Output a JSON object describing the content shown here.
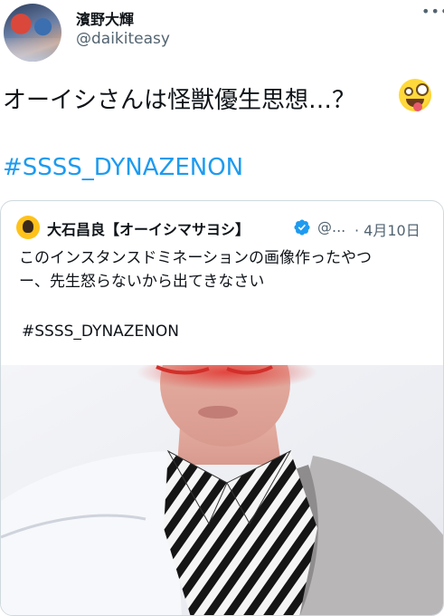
{
  "author": {
    "display_name": "濱野大輝",
    "handle": "@daikiteasy",
    "more_label": "•••"
  },
  "tweet": {
    "text": "オーイシさんは怪獣優生思想…？",
    "emoji": "zany-face-emoji",
    "hashtag": "#SSSS_DYNAZENON"
  },
  "quote": {
    "display_name": "大石昌良【オーイシマサヨシ】",
    "handle": "@...",
    "date": "· 4月10日",
    "body_lines": [
      "このインスタンスドミネーションの画像作ったやつ",
      "ー、先生怒らないから出てきなさい"
    ],
    "hashtag": "#SSSS_DYNAZENON",
    "verified_color": "#1d9bf0"
  },
  "colors": {
    "link": "#1d9bf0",
    "secondary_text": "#536471",
    "border": "#cfd9de"
  }
}
